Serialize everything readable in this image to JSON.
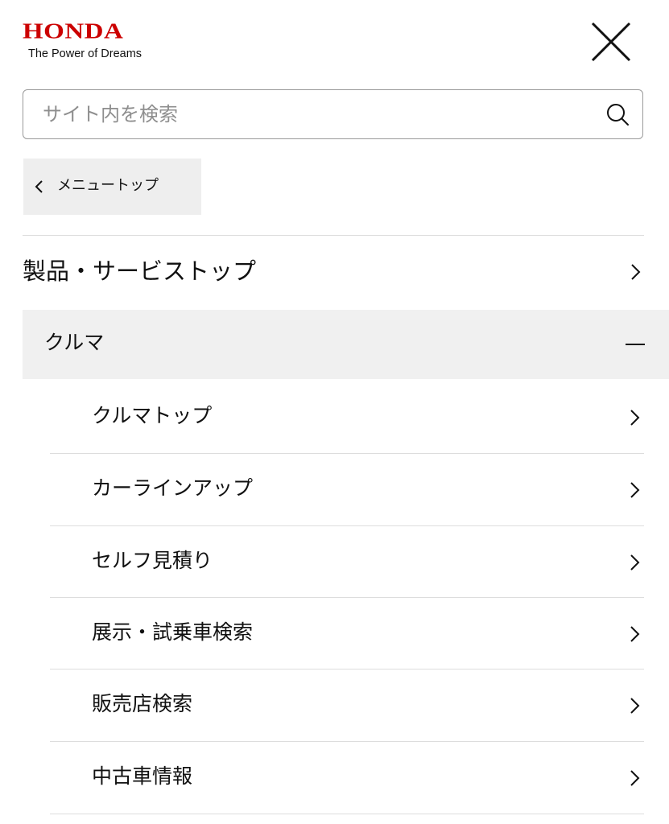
{
  "header": {
    "logo_text": "HONDA",
    "tagline": "The Power of Dreams",
    "brand_color": "#cc0000",
    "close_icon": "close-icon"
  },
  "search": {
    "placeholder": "サイト内を検索",
    "value": "",
    "icon": "search-icon"
  },
  "back": {
    "label": "メニュートップ",
    "icon": "chevron-left-icon"
  },
  "menu": {
    "top_item": {
      "label": "製品・サービストップ",
      "icon": "chevron-right-icon"
    },
    "section": {
      "label": "クルマ",
      "expanded": true,
      "icon": "minus-icon",
      "items": [
        {
          "label": "クルマトップ"
        },
        {
          "label": "カーラインアップ"
        },
        {
          "label": "セルフ見積り"
        },
        {
          "label": "展示・試乗車検索"
        },
        {
          "label": "販売店検索"
        },
        {
          "label": "中古車情報"
        }
      ]
    }
  },
  "colors": {
    "text": "#111111",
    "divider": "#dddddd",
    "back_button_bg": "#eeeeee",
    "section_bg": "#f0f0f0",
    "search_border": "#9a9a9a"
  }
}
